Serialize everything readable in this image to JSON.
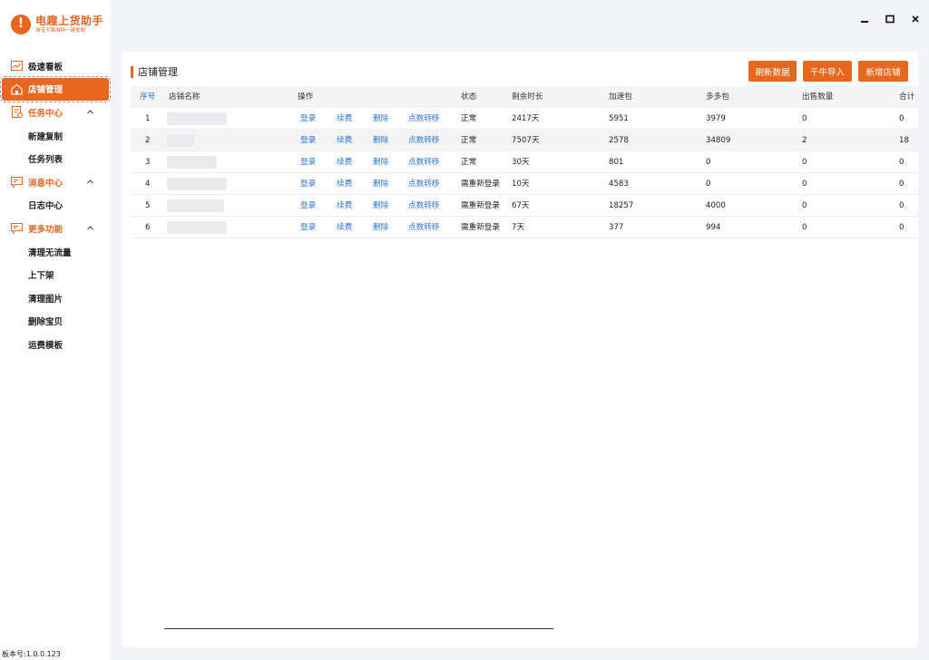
{
  "app": {
    "title": "电趣上货助手",
    "subtitle": "淘宝天猫淘特一键复制",
    "version": "板本号:1.0.0.123"
  },
  "sidebar": {
    "items": [
      {
        "label": "极速看板",
        "icon": "chart-icon"
      },
      {
        "label": "店铺管理",
        "icon": "store-icon"
      },
      {
        "label": "任务中心",
        "icon": "task-icon"
      },
      {
        "label": "新建复制"
      },
      {
        "label": "任务列表"
      },
      {
        "label": "消息中心",
        "icon": "message-icon"
      },
      {
        "label": "日志中心"
      },
      {
        "label": "更多功能",
        "icon": "more-icon"
      },
      {
        "label": "清理无流量"
      },
      {
        "label": "上下架"
      },
      {
        "label": "清理图片"
      },
      {
        "label": "删除宝贝"
      },
      {
        "label": "运费模板"
      }
    ]
  },
  "window": {
    "minimize": "–",
    "maximize": "□",
    "close": "×"
  },
  "panel": {
    "title": "店铺管理",
    "buttons": {
      "refresh": "刷新数据",
      "import": "千牛导入",
      "add": "新增店铺"
    }
  },
  "table": {
    "headers": {
      "seq": "序号",
      "name": "店铺名称",
      "ops": "操作",
      "status": "状态",
      "remaining": "剩余时长",
      "speed": "加速包",
      "duo": "多多包",
      "sold": "出售数量",
      "total": "合计"
    },
    "actions": [
      "登录",
      "续费",
      "删除",
      "点数转移"
    ],
    "rows": [
      {
        "seq": "1",
        "status": "正常",
        "remaining": "2417天",
        "speed": "5951",
        "duo": "3979",
        "sold": "0",
        "total": "0"
      },
      {
        "seq": "2",
        "status": "正常",
        "remaining": "7507天",
        "speed": "2578",
        "duo": "34809",
        "sold": "2",
        "total": "18"
      },
      {
        "seq": "3",
        "status": "正常",
        "remaining": "30天",
        "speed": "801",
        "duo": "0",
        "sold": "0",
        "total": "0"
      },
      {
        "seq": "4",
        "status": "需重新登录",
        "remaining": "10天",
        "speed": "4583",
        "duo": "0",
        "sold": "0",
        "total": "0"
      },
      {
        "seq": "5",
        "status": "需重新登录",
        "remaining": "67天",
        "speed": "18257",
        "duo": "4000",
        "sold": "0",
        "total": "0"
      },
      {
        "seq": "6",
        "status": "需重新登录",
        "remaining": "7天",
        "speed": "377",
        "duo": "994",
        "sold": "0",
        "total": "0"
      }
    ]
  },
  "colors": {
    "accent": "#e8661d",
    "link": "#2a73d8"
  }
}
